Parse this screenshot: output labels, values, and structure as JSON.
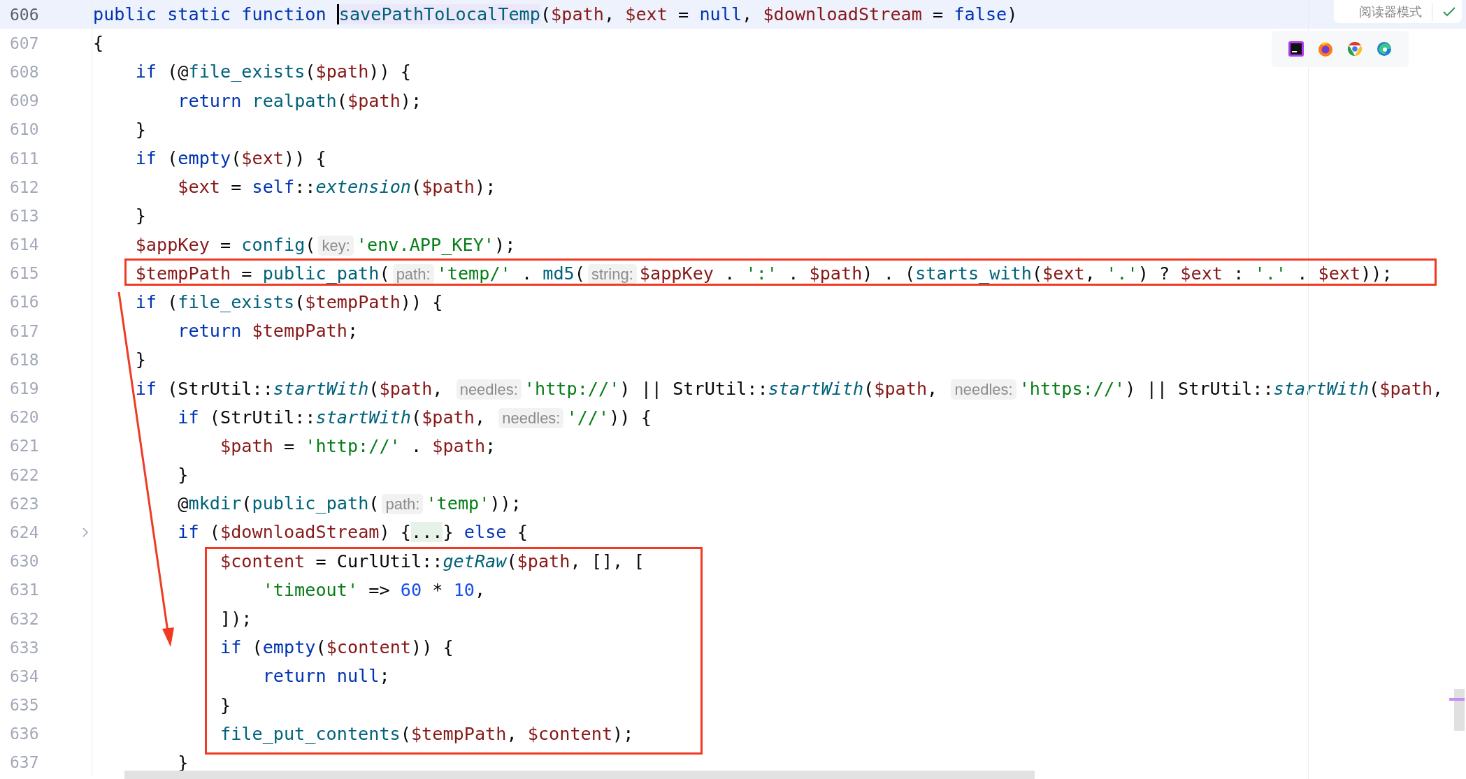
{
  "reader_mode": {
    "label": "阅读器模式"
  },
  "editor": {
    "lines": [
      {
        "number": "606",
        "current": true,
        "fold": false,
        "tokens": [
          {
            "kind": "kw",
            "text": "public static function "
          },
          {
            "kind": "decl",
            "text": "savePathToLocalTemp"
          },
          {
            "kind": "p",
            "text": "("
          },
          {
            "kind": "var",
            "text": "$path"
          },
          {
            "kind": "p",
            "text": ", "
          },
          {
            "kind": "var",
            "text": "$ext"
          },
          {
            "kind": "p",
            "text": " = "
          },
          {
            "kind": "kw",
            "text": "null"
          },
          {
            "kind": "p",
            "text": ", "
          },
          {
            "kind": "var",
            "text": "$downloadStream"
          },
          {
            "kind": "p",
            "text": " = "
          },
          {
            "kind": "kw",
            "text": "false"
          },
          {
            "kind": "p",
            "text": ")"
          }
        ]
      },
      {
        "number": "607",
        "current": false,
        "fold": false,
        "tokens": [
          {
            "kind": "p",
            "text": "{"
          }
        ]
      },
      {
        "number": "608",
        "current": false,
        "fold": false,
        "tokens": [
          {
            "kind": "kw",
            "text": "    if"
          },
          {
            "kind": "p",
            "text": " (@"
          },
          {
            "kind": "fn",
            "text": "file_exists"
          },
          {
            "kind": "p",
            "text": "("
          },
          {
            "kind": "var",
            "text": "$path"
          },
          {
            "kind": "p",
            "text": ")) {"
          }
        ]
      },
      {
        "number": "609",
        "current": false,
        "fold": false,
        "tokens": [
          {
            "kind": "kw",
            "text": "        return "
          },
          {
            "kind": "fn",
            "text": "realpath"
          },
          {
            "kind": "p",
            "text": "("
          },
          {
            "kind": "var",
            "text": "$path"
          },
          {
            "kind": "p",
            "text": ");"
          }
        ]
      },
      {
        "number": "610",
        "current": false,
        "fold": false,
        "tokens": [
          {
            "kind": "p",
            "text": "    }"
          }
        ]
      },
      {
        "number": "611",
        "current": false,
        "fold": false,
        "tokens": [
          {
            "kind": "kw",
            "text": "    if"
          },
          {
            "kind": "p",
            "text": " ("
          },
          {
            "kind": "kw",
            "text": "empty"
          },
          {
            "kind": "p",
            "text": "("
          },
          {
            "kind": "var",
            "text": "$ext"
          },
          {
            "kind": "p",
            "text": ")) {"
          }
        ]
      },
      {
        "number": "612",
        "current": false,
        "fold": false,
        "tokens": [
          {
            "kind": "var",
            "text": "        $ext"
          },
          {
            "kind": "p",
            "text": " = "
          },
          {
            "kind": "kw",
            "text": "self"
          },
          {
            "kind": "p",
            "text": "::"
          },
          {
            "kind": "it",
            "text": "extension"
          },
          {
            "kind": "p",
            "text": "("
          },
          {
            "kind": "var",
            "text": "$path"
          },
          {
            "kind": "p",
            "text": ");"
          }
        ]
      },
      {
        "number": "613",
        "current": false,
        "fold": false,
        "tokens": [
          {
            "kind": "p",
            "text": "    }"
          }
        ]
      },
      {
        "number": "614",
        "current": false,
        "fold": false,
        "tokens": [
          {
            "kind": "var",
            "text": "    $appKey"
          },
          {
            "kind": "p",
            "text": " = "
          },
          {
            "kind": "fn",
            "text": "config"
          },
          {
            "kind": "p",
            "text": "("
          },
          {
            "kind": "hint",
            "text": "key:"
          },
          {
            "kind": "str",
            "text": "'env.APP_KEY'"
          },
          {
            "kind": "p",
            "text": ");"
          }
        ]
      },
      {
        "number": "615",
        "current": false,
        "fold": false,
        "tokens": [
          {
            "kind": "var",
            "text": "    $tempPath"
          },
          {
            "kind": "p",
            "text": " = "
          },
          {
            "kind": "fn",
            "text": "public_path"
          },
          {
            "kind": "p",
            "text": "("
          },
          {
            "kind": "hint",
            "text": "path:"
          },
          {
            "kind": "str",
            "text": "'temp/'"
          },
          {
            "kind": "p",
            "text": " . "
          },
          {
            "kind": "fn",
            "text": "md5"
          },
          {
            "kind": "p",
            "text": "("
          },
          {
            "kind": "hint",
            "text": "string:"
          },
          {
            "kind": "var",
            "text": "$appKey"
          },
          {
            "kind": "p",
            "text": " . "
          },
          {
            "kind": "str",
            "text": "':'"
          },
          {
            "kind": "p",
            "text": " . "
          },
          {
            "kind": "var",
            "text": "$path"
          },
          {
            "kind": "p",
            "text": ") . ("
          },
          {
            "kind": "fn",
            "text": "starts_with"
          },
          {
            "kind": "p",
            "text": "("
          },
          {
            "kind": "var",
            "text": "$ext"
          },
          {
            "kind": "p",
            "text": ", "
          },
          {
            "kind": "str",
            "text": "'.'"
          },
          {
            "kind": "p",
            "text": ") ? "
          },
          {
            "kind": "var",
            "text": "$ext"
          },
          {
            "kind": "p",
            "text": " : "
          },
          {
            "kind": "str",
            "text": "'.'"
          },
          {
            "kind": "p",
            "text": " . "
          },
          {
            "kind": "var",
            "text": "$ext"
          },
          {
            "kind": "p",
            "text": "));"
          }
        ]
      },
      {
        "number": "616",
        "current": false,
        "fold": false,
        "tokens": [
          {
            "kind": "kw",
            "text": "    if"
          },
          {
            "kind": "p",
            "text": " ("
          },
          {
            "kind": "fn",
            "text": "file_exists"
          },
          {
            "kind": "p",
            "text": "("
          },
          {
            "kind": "var",
            "text": "$tempPath"
          },
          {
            "kind": "p",
            "text": ")) {"
          }
        ]
      },
      {
        "number": "617",
        "current": false,
        "fold": false,
        "tokens": [
          {
            "kind": "kw",
            "text": "        return "
          },
          {
            "kind": "var",
            "text": "$tempPath"
          },
          {
            "kind": "p",
            "text": ";"
          }
        ]
      },
      {
        "number": "618",
        "current": false,
        "fold": false,
        "tokens": [
          {
            "kind": "p",
            "text": "    }"
          }
        ]
      },
      {
        "number": "619",
        "current": false,
        "fold": false,
        "tokens": [
          {
            "kind": "kw",
            "text": "    if"
          },
          {
            "kind": "p",
            "text": " (StrUtil::"
          },
          {
            "kind": "it",
            "text": "startWith"
          },
          {
            "kind": "p",
            "text": "("
          },
          {
            "kind": "var",
            "text": "$path"
          },
          {
            "kind": "p",
            "text": ", "
          },
          {
            "kind": "hint",
            "text": "needles:"
          },
          {
            "kind": "str",
            "text": "'http://'"
          },
          {
            "kind": "p",
            "text": ") || StrUtil::"
          },
          {
            "kind": "it",
            "text": "startWith"
          },
          {
            "kind": "p",
            "text": "("
          },
          {
            "kind": "var",
            "text": "$path"
          },
          {
            "kind": "p",
            "text": ", "
          },
          {
            "kind": "hint",
            "text": "needles:"
          },
          {
            "kind": "str",
            "text": "'https://'"
          },
          {
            "kind": "p",
            "text": ") || StrUtil::"
          },
          {
            "kind": "it",
            "text": "startWith"
          },
          {
            "kind": "p",
            "text": "("
          },
          {
            "kind": "var",
            "text": "$path"
          },
          {
            "kind": "p",
            "text": ","
          }
        ]
      },
      {
        "number": "620",
        "current": false,
        "fold": false,
        "tokens": [
          {
            "kind": "kw",
            "text": "        if"
          },
          {
            "kind": "p",
            "text": " (StrUtil::"
          },
          {
            "kind": "it",
            "text": "startWith"
          },
          {
            "kind": "p",
            "text": "("
          },
          {
            "kind": "var",
            "text": "$path"
          },
          {
            "kind": "p",
            "text": ", "
          },
          {
            "kind": "hint",
            "text": "needles:"
          },
          {
            "kind": "str",
            "text": "'//'"
          },
          {
            "kind": "p",
            "text": ")) {"
          }
        ]
      },
      {
        "number": "621",
        "current": false,
        "fold": false,
        "tokens": [
          {
            "kind": "var",
            "text": "            $path"
          },
          {
            "kind": "p",
            "text": " = "
          },
          {
            "kind": "str",
            "text": "'http://'"
          },
          {
            "kind": "p",
            "text": " . "
          },
          {
            "kind": "var",
            "text": "$path"
          },
          {
            "kind": "p",
            "text": ";"
          }
        ]
      },
      {
        "number": "622",
        "current": false,
        "fold": false,
        "tokens": [
          {
            "kind": "p",
            "text": "        }"
          }
        ]
      },
      {
        "number": "623",
        "current": false,
        "fold": false,
        "tokens": [
          {
            "kind": "p",
            "text": "        @"
          },
          {
            "kind": "fn",
            "text": "mkdir"
          },
          {
            "kind": "p",
            "text": "("
          },
          {
            "kind": "fn",
            "text": "public_path"
          },
          {
            "kind": "p",
            "text": "("
          },
          {
            "kind": "hint",
            "text": "path:"
          },
          {
            "kind": "str",
            "text": "'temp'"
          },
          {
            "kind": "p",
            "text": "));"
          }
        ]
      },
      {
        "number": "624",
        "current": false,
        "fold": true,
        "tokens": [
          {
            "kind": "kw",
            "text": "        if"
          },
          {
            "kind": "p",
            "text": " ("
          },
          {
            "kind": "var",
            "text": "$downloadStream"
          },
          {
            "kind": "p",
            "text": ") {"
          },
          {
            "kind": "folded",
            "text": "..."
          },
          {
            "kind": "p",
            "text": "} "
          },
          {
            "kind": "kw",
            "text": "else"
          },
          {
            "kind": "p",
            "text": " {"
          }
        ]
      },
      {
        "number": "630",
        "current": false,
        "fold": false,
        "tokens": [
          {
            "kind": "var",
            "text": "            $content"
          },
          {
            "kind": "p",
            "text": " = CurlUtil::"
          },
          {
            "kind": "it",
            "text": "getRaw"
          },
          {
            "kind": "p",
            "text": "("
          },
          {
            "kind": "var",
            "text": "$path"
          },
          {
            "kind": "p",
            "text": ", [], ["
          }
        ]
      },
      {
        "number": "631",
        "current": false,
        "fold": false,
        "tokens": [
          {
            "kind": "str",
            "text": "                'timeout'"
          },
          {
            "kind": "p",
            "text": " => "
          },
          {
            "kind": "num",
            "text": "60"
          },
          {
            "kind": "p",
            "text": " * "
          },
          {
            "kind": "num",
            "text": "10"
          },
          {
            "kind": "p",
            "text": ","
          }
        ]
      },
      {
        "number": "632",
        "current": false,
        "fold": false,
        "tokens": [
          {
            "kind": "p",
            "text": "            ]);"
          }
        ]
      },
      {
        "number": "633",
        "current": false,
        "fold": false,
        "tokens": [
          {
            "kind": "kw",
            "text": "            if"
          },
          {
            "kind": "p",
            "text": " ("
          },
          {
            "kind": "kw",
            "text": "empty"
          },
          {
            "kind": "p",
            "text": "("
          },
          {
            "kind": "var",
            "text": "$content"
          },
          {
            "kind": "p",
            "text": ")) {"
          }
        ]
      },
      {
        "number": "634",
        "current": false,
        "fold": false,
        "tokens": [
          {
            "kind": "kw",
            "text": "                return null"
          },
          {
            "kind": "p",
            "text": ";"
          }
        ]
      },
      {
        "number": "635",
        "current": false,
        "fold": false,
        "tokens": [
          {
            "kind": "p",
            "text": "            }"
          }
        ]
      },
      {
        "number": "636",
        "current": false,
        "fold": false,
        "tokens": [
          {
            "kind": "fn",
            "text": "            file_put_contents"
          },
          {
            "kind": "p",
            "text": "("
          },
          {
            "kind": "var",
            "text": "$tempPath"
          },
          {
            "kind": "p",
            "text": ", "
          },
          {
            "kind": "var",
            "text": "$content"
          },
          {
            "kind": "p",
            "text": ");"
          }
        ]
      },
      {
        "number": "637",
        "current": false,
        "fold": false,
        "tokens": [
          {
            "kind": "p",
            "text": "        }"
          }
        ]
      }
    ]
  }
}
